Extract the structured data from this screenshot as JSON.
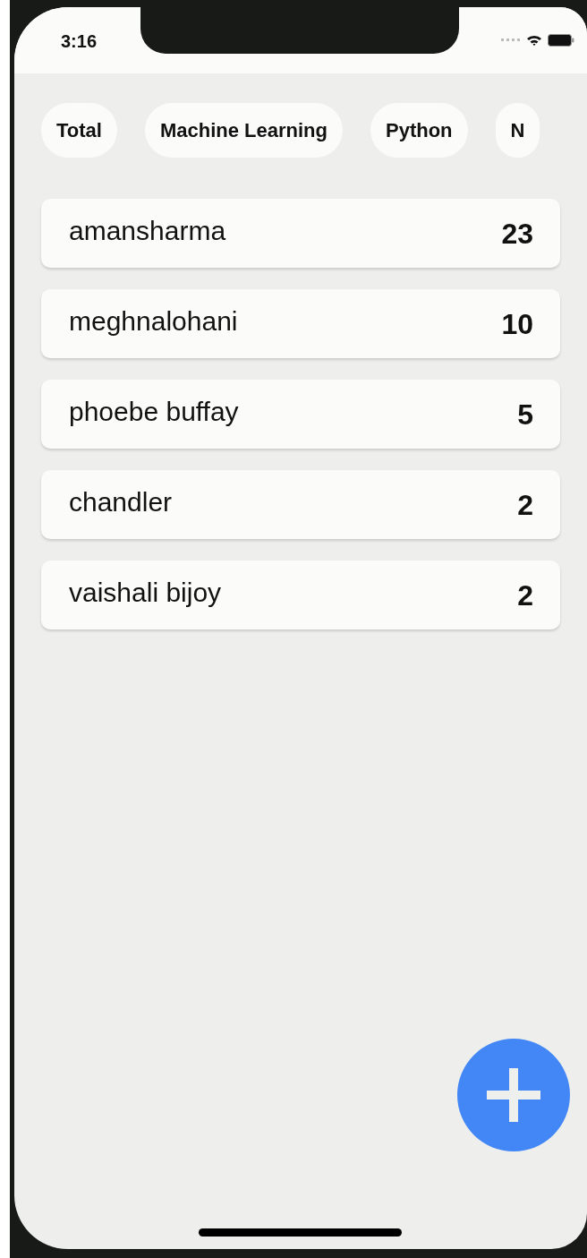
{
  "status_bar": {
    "time": "3:16"
  },
  "filters": [
    {
      "label": "Total"
    },
    {
      "label": "Machine Learning"
    },
    {
      "label": "Python"
    },
    {
      "label": "N"
    }
  ],
  "leaderboard": [
    {
      "name": "amansharma",
      "count": "23"
    },
    {
      "name": "meghnalohani",
      "count": "10"
    },
    {
      "name": "phoebe buffay",
      "count": "5"
    },
    {
      "name": "chandler",
      "count": "2"
    },
    {
      "name": "vaishali bijoy",
      "count": "2"
    }
  ]
}
